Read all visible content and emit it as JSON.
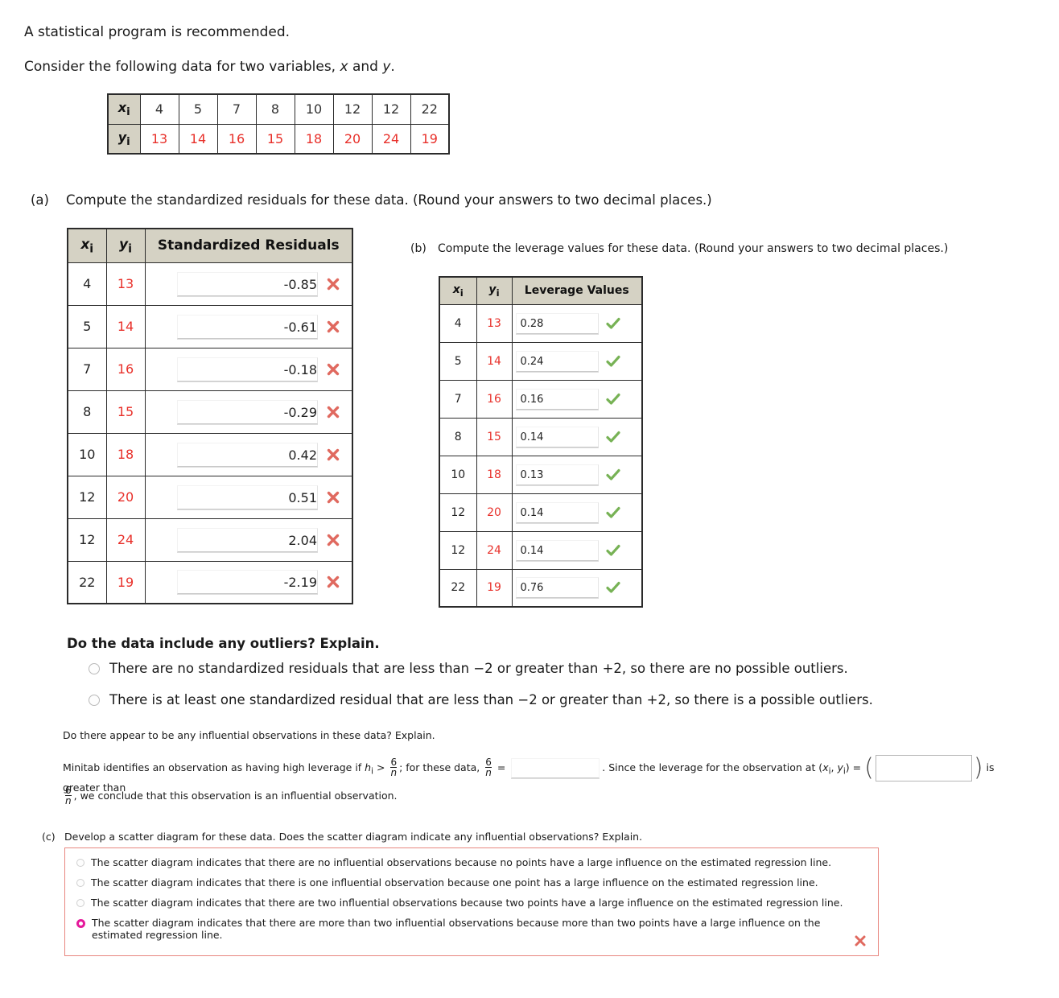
{
  "intro": {
    "line1": "A statistical program is recommended.",
    "line2_pre": "Consider the following data for two variables, ",
    "line2_x": "x",
    "line2_mid": " and ",
    "line2_y": "y",
    "line2_end": "."
  },
  "data_table": {
    "x_label": "x",
    "y_label": "y",
    "sub": "i",
    "x_values": [
      "4",
      "5",
      "7",
      "8",
      "10",
      "12",
      "12",
      "22"
    ],
    "y_values": [
      "13",
      "14",
      "16",
      "15",
      "18",
      "20",
      "24",
      "19"
    ]
  },
  "part_a": {
    "label": "(a)",
    "text": "Compute the standardized residuals for these data. (Round your answers to two decimal places.)",
    "table": {
      "header_x": "x",
      "header_y": "y",
      "header_value": "Standardized Residuals",
      "rows": [
        {
          "x": "4",
          "y": "13",
          "value": "-0.85",
          "mark": "incorrect"
        },
        {
          "x": "5",
          "y": "14",
          "value": "-0.61",
          "mark": "incorrect"
        },
        {
          "x": "7",
          "y": "16",
          "value": "-0.18",
          "mark": "incorrect"
        },
        {
          "x": "8",
          "y": "15",
          "value": "-0.29",
          "mark": "incorrect"
        },
        {
          "x": "10",
          "y": "18",
          "value": "0.42",
          "mark": "incorrect"
        },
        {
          "x": "12",
          "y": "20",
          "value": "0.51",
          "mark": "incorrect"
        },
        {
          "x": "12",
          "y": "24",
          "value": "2.04",
          "mark": "incorrect"
        },
        {
          "x": "22",
          "y": "19",
          "value": "-2.19",
          "mark": "incorrect"
        }
      ]
    }
  },
  "part_b": {
    "label": "(b)",
    "text": "Compute the leverage values for these data. (Round your answers to two decimal places.)",
    "table": {
      "header_x": "x",
      "header_y": "y",
      "header_value": "Leverage Values",
      "rows": [
        {
          "x": "4",
          "y": "13",
          "value": "0.28",
          "mark": "correct"
        },
        {
          "x": "5",
          "y": "14",
          "value": "0.24",
          "mark": "correct"
        },
        {
          "x": "7",
          "y": "16",
          "value": "0.16",
          "mark": "correct"
        },
        {
          "x": "8",
          "y": "15",
          "value": "0.14",
          "mark": "correct"
        },
        {
          "x": "10",
          "y": "18",
          "value": "0.13",
          "mark": "correct"
        },
        {
          "x": "12",
          "y": "20",
          "value": "0.14",
          "mark": "correct"
        },
        {
          "x": "12",
          "y": "24",
          "value": "0.14",
          "mark": "correct"
        },
        {
          "x": "22",
          "y": "19",
          "value": "0.76",
          "mark": "correct"
        }
      ]
    }
  },
  "outliers": {
    "question": "Do the data include any outliers? Explain.",
    "options": [
      "There are no standardized residuals that are less than −2 or greater than +2, so there are no possible outliers.",
      "There is at least one standardized residual that are less than −2 or greater than +2, so there is a possible outliers."
    ],
    "selected": -1
  },
  "influential": {
    "question": "Do there appear to be any influential observations in these data? Explain.",
    "sentence_1": "Minitab identifies an observation as having high leverage if ",
    "h_symbol": "h",
    "h_sub": "i",
    "gt": " > ",
    "frac_num": "6",
    "frac_den": "n",
    "sentence_2": "; for these data, ",
    "equals": " = ",
    "value_1": "",
    "sentence_3": ". Since the leverage for the observation at (",
    "pair_x": "x",
    "pair_y": "y",
    "pair_sub": "i",
    "sentence_4": ") = ",
    "value_2": "",
    "sentence_5": " is greater than ",
    "conclusion": ", we conclude that this observation is an influential observation."
  },
  "part_c": {
    "label": "(c)",
    "text": "Develop a scatter diagram for these data. Does the scatter diagram indicate any influential observations? Explain.",
    "options": [
      "The scatter diagram indicates that there are no influential observations because no points have a large influence on the estimated regression line.",
      "The scatter diagram indicates that there is one influential observation because one point has a large influence on the estimated regression line.",
      "The scatter diagram indicates that there are two influential observations because two points have a large influence on the estimated regression line.",
      "The scatter diagram indicates that there are more than two influential observations because more than two points have a large influence on the estimated regression line."
    ],
    "selected": 3,
    "result": "incorrect"
  },
  "colors": {
    "header_bg": "#d5d2c4",
    "y_value_red": "#e8302a",
    "incorrect_x": "#e0695f",
    "correct_check": "#77b255",
    "selected_radio": "#e5199b",
    "error_border": "#e8867f"
  }
}
